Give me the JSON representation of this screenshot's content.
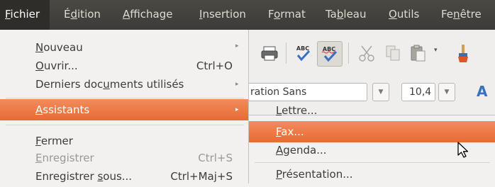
{
  "menubar": {
    "items": [
      {
        "pre": "",
        "u": "F",
        "post": "ichier"
      },
      {
        "pre": "É",
        "u": "d",
        "post": "ition"
      },
      {
        "pre": "",
        "u": "A",
        "post": "ffichage"
      },
      {
        "pre": "",
        "u": "I",
        "post": "nsertion"
      },
      {
        "pre": "F",
        "u": "o",
        "post": "rmat"
      },
      {
        "pre": "Ta",
        "u": "b",
        "post": "leau"
      },
      {
        "pre": "",
        "u": "O",
        "post": "utils"
      },
      {
        "pre": "Fe",
        "u": "n",
        "post": "être"
      }
    ]
  },
  "fichier_menu": {
    "nouveau": {
      "pre": "",
      "u": "N",
      "post": "ouveau"
    },
    "ouvrir": {
      "pre": "",
      "u": "O",
      "post": "uvrir...",
      "accel": "Ctrl+O"
    },
    "derniers": {
      "pre": "Derniers doc",
      "u": "u",
      "post": "ments utilisés"
    },
    "assistants": {
      "pre": "",
      "u": "A",
      "post": "ssistants"
    },
    "fermer": {
      "pre": "",
      "u": "F",
      "post": "ermer"
    },
    "enregistrer": {
      "pre": "",
      "u": "E",
      "post": "nregistrer",
      "accel": "Ctrl+S"
    },
    "enregistrer_sous": {
      "pre": "Enregistrer ",
      "u": "s",
      "post": "ous...",
      "accel": "Ctrl+Maj+S"
    }
  },
  "assistants_menu": {
    "lettre": {
      "pre": "",
      "u": "L",
      "post": "ettre..."
    },
    "fax": {
      "pre": "",
      "u": "F",
      "post": "ax..."
    },
    "agenda": {
      "pre": "",
      "u": "A",
      "post": "genda..."
    },
    "presentation": {
      "pre": "",
      "u": "P",
      "post": "résentation..."
    }
  },
  "toolbar": {
    "font_name": "ration Sans",
    "font_size": "10,4",
    "abc_label": "ABC"
  },
  "colors": {
    "highlight": "#e86a34",
    "menubar_bg": "#3c3b37",
    "menu_bg": "#f2f1f0"
  }
}
